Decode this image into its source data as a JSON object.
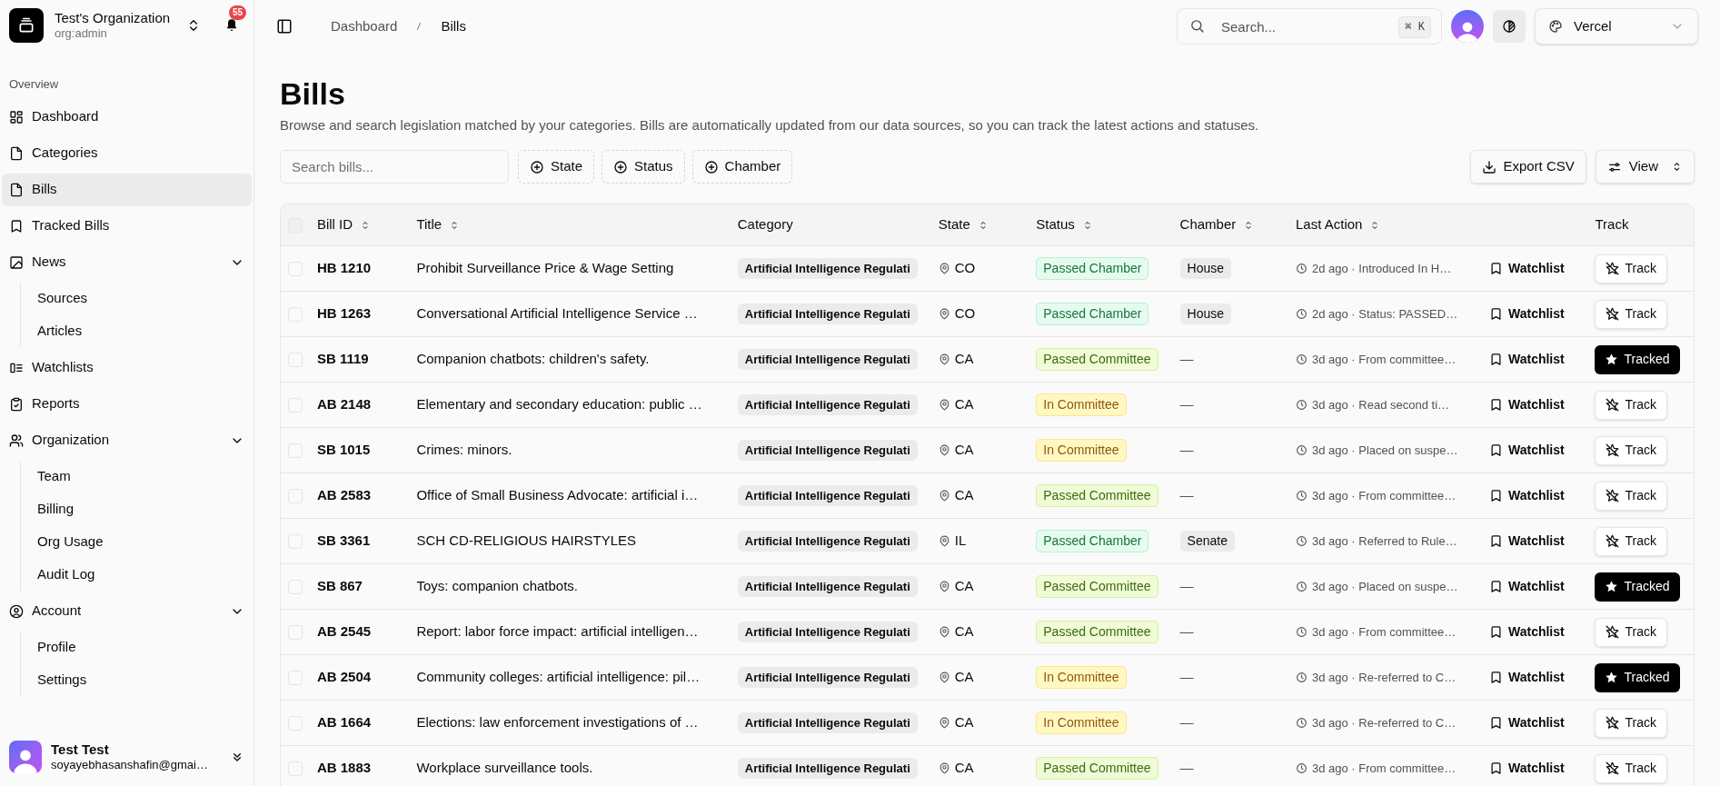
{
  "org": {
    "name": "Test's Organization",
    "role": "org:admin",
    "notifications": "55"
  },
  "sidebar": {
    "section": "Overview",
    "items": [
      {
        "label": "Dashboard",
        "selected": false
      },
      {
        "label": "Categories",
        "selected": false
      },
      {
        "label": "Bills",
        "selected": true
      },
      {
        "label": "Tracked Bills",
        "selected": false
      },
      {
        "label": "News",
        "selected": false,
        "expanded": true,
        "children": [
          {
            "label": "Sources"
          },
          {
            "label": "Articles"
          }
        ]
      },
      {
        "label": "Watchlists",
        "selected": false
      },
      {
        "label": "Reports",
        "selected": false
      },
      {
        "label": "Organization",
        "selected": false,
        "expanded": true,
        "children": [
          {
            "label": "Team"
          },
          {
            "label": "Billing"
          },
          {
            "label": "Org Usage"
          },
          {
            "label": "Audit Log"
          }
        ]
      },
      {
        "label": "Account",
        "selected": false,
        "expanded": true,
        "children": [
          {
            "label": "Profile"
          },
          {
            "label": "Settings"
          }
        ]
      }
    ]
  },
  "user": {
    "name": "Test Test",
    "email": "soyayebhasanshafin@gmai…"
  },
  "breadcrumb": [
    "Dashboard",
    "Bills"
  ],
  "search": {
    "placeholder": "Search...",
    "shortcut": "⌘ K"
  },
  "theme_select": {
    "value": "Vercel"
  },
  "page": {
    "title": "Bills",
    "description": "Browse and search legislation matched by your categories. Bills are automatically updated from our data sources, so you can track the latest actions and statuses."
  },
  "toolbar": {
    "search_placeholder": "Search bills...",
    "filters": [
      "State",
      "Status",
      "Chamber"
    ],
    "export": "Export CSV",
    "view": "View"
  },
  "table": {
    "select_all_checked": false,
    "columns": [
      {
        "label": "Bill ID",
        "sortable": true
      },
      {
        "label": "Title",
        "sortable": true
      },
      {
        "label": "Category",
        "sortable": false
      },
      {
        "label": "State",
        "sortable": true
      },
      {
        "label": "Status",
        "sortable": true
      },
      {
        "label": "Chamber",
        "sortable": true
      },
      {
        "label": "Last Action",
        "sortable": true
      },
      {
        "label": "Track",
        "sortable": false
      }
    ],
    "rows": [
      {
        "checked": false,
        "id": "HB 1210",
        "title": "Prohibit Surveillance Price & Wage Setting",
        "category": "Artificial Intelligence Regulati",
        "state": "CO",
        "status": {
          "label": "Passed Chamber",
          "kind": "chamber"
        },
        "chamber": {
          "label": "House",
          "kind": "badge"
        },
        "last_action": "2d ago · Introduced In H…",
        "watchlist": "Watchlist",
        "track": {
          "label": "Track",
          "tracked": false
        }
      },
      {
        "checked": false,
        "id": "HB 1263",
        "title": "Conversational Artificial Intelligence Service …",
        "category": "Artificial Intelligence Regulati",
        "state": "CO",
        "status": {
          "label": "Passed Chamber",
          "kind": "chamber"
        },
        "chamber": {
          "label": "House",
          "kind": "badge"
        },
        "last_action": "2d ago · Status: PASSED…",
        "watchlist": "Watchlist",
        "track": {
          "label": "Track",
          "tracked": false
        }
      },
      {
        "checked": false,
        "id": "SB 1119",
        "title": "Companion chatbots: children's safety.",
        "category": "Artificial Intelligence Regulati",
        "state": "CA",
        "status": {
          "label": "Passed Committee",
          "kind": "committee"
        },
        "chamber": {
          "label": "—",
          "kind": "none"
        },
        "last_action": "3d ago · From committee…",
        "watchlist": "Watchlist",
        "track": {
          "label": "Tracked",
          "tracked": true
        }
      },
      {
        "checked": false,
        "id": "AB 2148",
        "title": "Elementary and secondary education: public …",
        "category": "Artificial Intelligence Regulati",
        "state": "CA",
        "status": {
          "label": "In Committee",
          "kind": "in_committee"
        },
        "chamber": {
          "label": "—",
          "kind": "none"
        },
        "last_action": "3d ago · Read second ti…",
        "watchlist": "Watchlist",
        "track": {
          "label": "Track",
          "tracked": false
        }
      },
      {
        "checked": false,
        "id": "SB 1015",
        "title": "Crimes: minors.",
        "category": "Artificial Intelligence Regulati",
        "state": "CA",
        "status": {
          "label": "In Committee",
          "kind": "in_committee"
        },
        "chamber": {
          "label": "—",
          "kind": "none"
        },
        "last_action": "3d ago · Placed on suspe…",
        "watchlist": "Watchlist",
        "track": {
          "label": "Track",
          "tracked": false
        }
      },
      {
        "checked": false,
        "id": "AB 2583",
        "title": "Office of Small Business Advocate: artificial i…",
        "category": "Artificial Intelligence Regulati",
        "state": "CA",
        "status": {
          "label": "Passed Committee",
          "kind": "committee"
        },
        "chamber": {
          "label": "—",
          "kind": "none"
        },
        "last_action": "3d ago · From committee…",
        "watchlist": "Watchlist",
        "track": {
          "label": "Track",
          "tracked": false
        }
      },
      {
        "checked": false,
        "id": "SB 3361",
        "title": "SCH CD-RELIGIOUS HAIRSTYLES",
        "category": "Artificial Intelligence Regulati",
        "state": "IL",
        "status": {
          "label": "Passed Chamber",
          "kind": "chamber"
        },
        "chamber": {
          "label": "Senate",
          "kind": "badge"
        },
        "last_action": "3d ago · Referred to Rule…",
        "watchlist": "Watchlist",
        "track": {
          "label": "Track",
          "tracked": false
        }
      },
      {
        "checked": false,
        "id": "SB 867",
        "title": "Toys: companion chatbots.",
        "category": "Artificial Intelligence Regulati",
        "state": "CA",
        "status": {
          "label": "Passed Committee",
          "kind": "committee"
        },
        "chamber": {
          "label": "—",
          "kind": "none"
        },
        "last_action": "3d ago · Placed on suspe…",
        "watchlist": "Watchlist",
        "track": {
          "label": "Tracked",
          "tracked": true
        }
      },
      {
        "checked": false,
        "id": "AB 2545",
        "title": "Report: labor force impact: artificial intelligen…",
        "category": "Artificial Intelligence Regulati",
        "state": "CA",
        "status": {
          "label": "Passed Committee",
          "kind": "committee"
        },
        "chamber": {
          "label": "—",
          "kind": "none"
        },
        "last_action": "3d ago · From committee…",
        "watchlist": "Watchlist",
        "track": {
          "label": "Track",
          "tracked": false
        }
      },
      {
        "checked": false,
        "id": "AB 2504",
        "title": "Community colleges: artificial intelligence: pil…",
        "category": "Artificial Intelligence Regulati",
        "state": "CA",
        "status": {
          "label": "In Committee",
          "kind": "in_committee"
        },
        "chamber": {
          "label": "—",
          "kind": "none"
        },
        "last_action": "3d ago · Re-referred to C…",
        "watchlist": "Watchlist",
        "track": {
          "label": "Tracked",
          "tracked": true
        }
      },
      {
        "checked": false,
        "id": "AB 1664",
        "title": "Elections: law enforcement investigations of …",
        "category": "Artificial Intelligence Regulati",
        "state": "CA",
        "status": {
          "label": "In Committee",
          "kind": "in_committee"
        },
        "chamber": {
          "label": "—",
          "kind": "none"
        },
        "last_action": "3d ago · Re-referred to C…",
        "watchlist": "Watchlist",
        "track": {
          "label": "Track",
          "tracked": false
        }
      },
      {
        "checked": false,
        "id": "AB 1883",
        "title": "Workplace surveillance tools.",
        "category": "Artificial Intelligence Regulati",
        "state": "CA",
        "status": {
          "label": "Passed Committee",
          "kind": "committee"
        },
        "chamber": {
          "label": "—",
          "kind": "none"
        },
        "last_action": "3d ago · From committee…",
        "watchlist": "Watchlist",
        "track": {
          "label": "Track",
          "tracked": false
        }
      }
    ]
  }
}
